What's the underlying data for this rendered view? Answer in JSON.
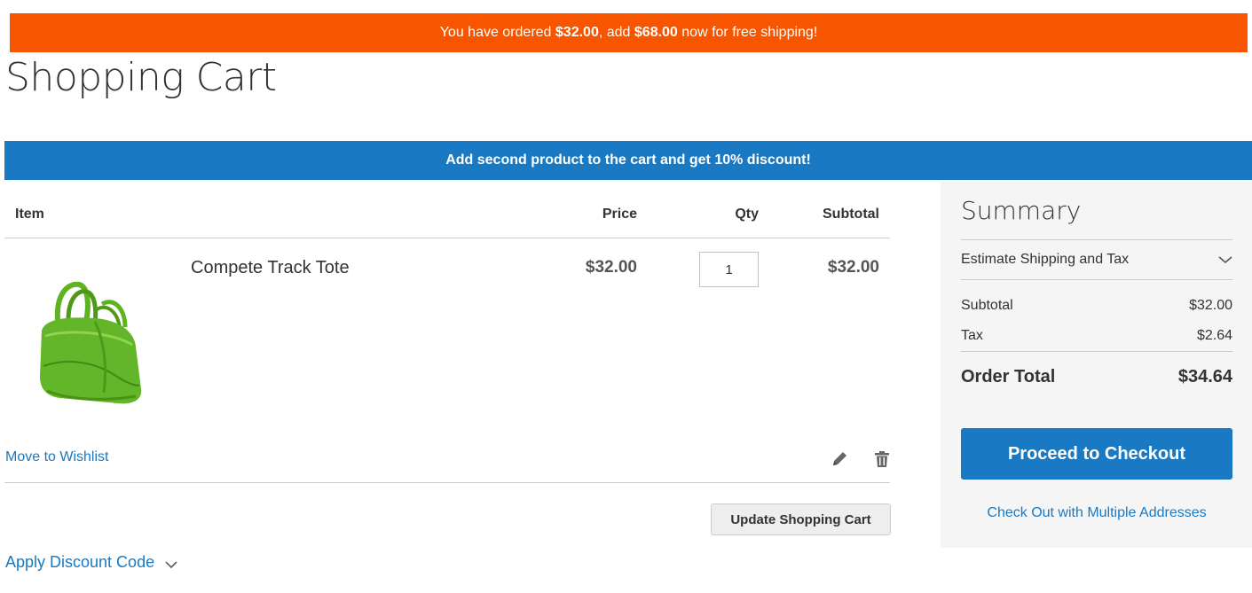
{
  "shipping_banner": {
    "prefix": "You have ordered",
    "ordered_amount": "$32.00",
    "middle": ", add",
    "remaining_amount": "$68.00",
    "suffix": "now for free shipping!",
    "color": "#f85500"
  },
  "page_title": "Shopping Cart",
  "promo_banner": {
    "text": "Add second product to the cart and get 10% discount!",
    "color": "#1979c3"
  },
  "cart": {
    "headers": {
      "item": "Item",
      "price": "Price",
      "qty": "Qty",
      "subtotal": "Subtotal"
    },
    "items": [
      {
        "name": "Compete Track Tote",
        "price": "$32.00",
        "qty": "1",
        "subtotal": "$32.00",
        "image_icon": "green-tote-bag-image"
      }
    ],
    "move_to_wishlist": "Move to Wishlist",
    "update_button": "Update Shopping Cart",
    "discount_toggle": "Apply Discount Code"
  },
  "summary": {
    "title": "Summary",
    "estimate_label": "Estimate Shipping and Tax",
    "subtotal_label": "Subtotal",
    "subtotal_value": "$32.00",
    "tax_label": "Tax",
    "tax_value": "$2.64",
    "order_total_label": "Order Total",
    "order_total_value": "$34.64",
    "checkout_button": "Proceed to Checkout",
    "multi_address_link": "Check Out with Multiple Addresses"
  },
  "colors": {
    "accent": "#1979c3",
    "alert": "#f85500"
  }
}
